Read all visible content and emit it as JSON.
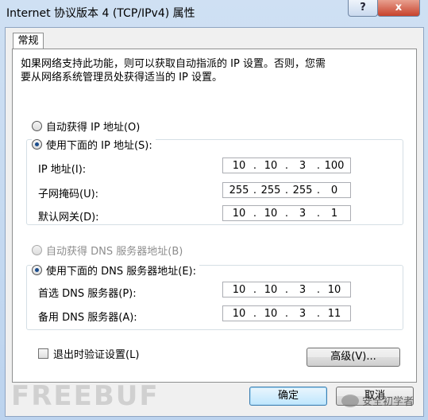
{
  "window": {
    "title": "Internet 协议版本 4 (TCP/IPv4) 属性",
    "help_label": "?",
    "close_label": "x"
  },
  "tabs": [
    {
      "label": "常规"
    }
  ],
  "description": "如果网络支持此功能，则可以获取自动指派的 IP 设置。否则，您需\n要从网络系统管理员处获得适当的 IP 设置。",
  "ip_section": {
    "auto_label": "自动获得 IP 地址(O)",
    "manual_label": "使用下面的 IP 地址(S):",
    "selected": "manual",
    "fields": [
      {
        "label": "IP 地址(I):",
        "octets": [
          "10",
          "10",
          "3",
          "100"
        ]
      },
      {
        "label": "子网掩码(U):",
        "octets": [
          "255",
          "255",
          "255",
          "0"
        ]
      },
      {
        "label": "默认网关(D):",
        "octets": [
          "10",
          "10",
          "3",
          "1"
        ]
      }
    ]
  },
  "dns_section": {
    "auto_label": "自动获得 DNS 服务器地址(B)",
    "manual_label": "使用下面的 DNS 服务器地址(E):",
    "selected": "manual",
    "fields": [
      {
        "label": "首选 DNS 服务器(P):",
        "octets": [
          "10",
          "10",
          "3",
          "10"
        ]
      },
      {
        "label": "备用 DNS 服务器(A):",
        "octets": [
          "10",
          "10",
          "3",
          "11"
        ]
      }
    ]
  },
  "validate_on_exit": {
    "label": "退出时验证设置(L)",
    "checked": false
  },
  "advanced_button": "高级(V)...",
  "ok_button": "确定",
  "cancel_button": "取消",
  "watermark": {
    "text": "FREEBUF",
    "account": "安全初学者"
  }
}
